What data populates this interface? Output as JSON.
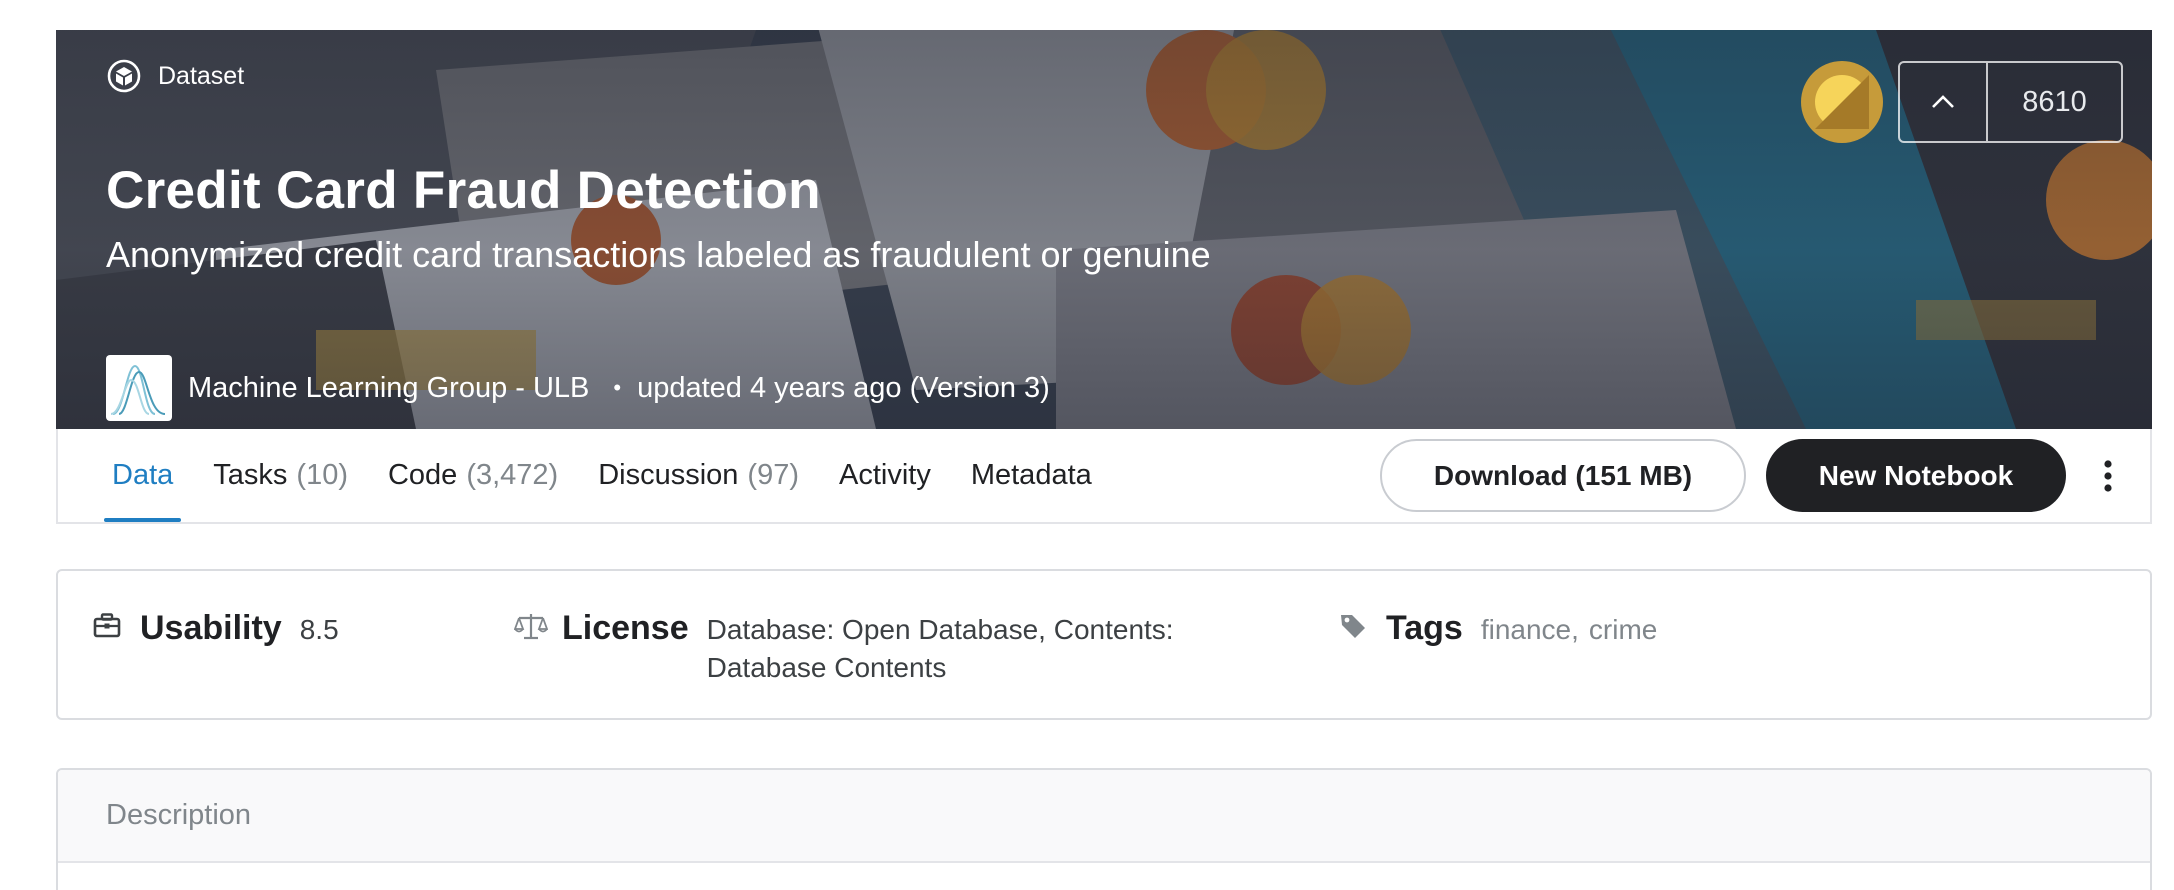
{
  "hero": {
    "type_label": "Dataset",
    "title": "Credit Card Fraud Detection",
    "subtitle": "Anonymized credit card transactions labeled as fraudulent or genuine",
    "owner_name": "Machine Learning Group - ULB",
    "separator": "•",
    "updated_text": "updated 4 years ago (Version 3)",
    "vote_count": "8610",
    "medal_color": "#c69b3a"
  },
  "tabs": [
    {
      "label": "Data",
      "count": ""
    },
    {
      "label": "Tasks",
      "count": "(10)"
    },
    {
      "label": "Code",
      "count": "(3,472)"
    },
    {
      "label": "Discussion",
      "count": "(97)"
    },
    {
      "label": "Activity",
      "count": ""
    },
    {
      "label": "Metadata",
      "count": ""
    }
  ],
  "actions": {
    "download_label": "Download (151 MB)",
    "new_notebook_label": "New Notebook"
  },
  "info": {
    "usability_label": "Usability",
    "usability_value": "8.5",
    "license_label": "License",
    "license_value": "Database: Open Database, Contents: Database Contents",
    "tags_label": "Tags",
    "tags": [
      "finance",
      "crime"
    ],
    "tag_separator": ","
  },
  "description": {
    "header": "Description"
  },
  "colors": {
    "accent": "#1f7ec2",
    "primary_button": "#202124",
    "muted_text": "#80868b"
  }
}
